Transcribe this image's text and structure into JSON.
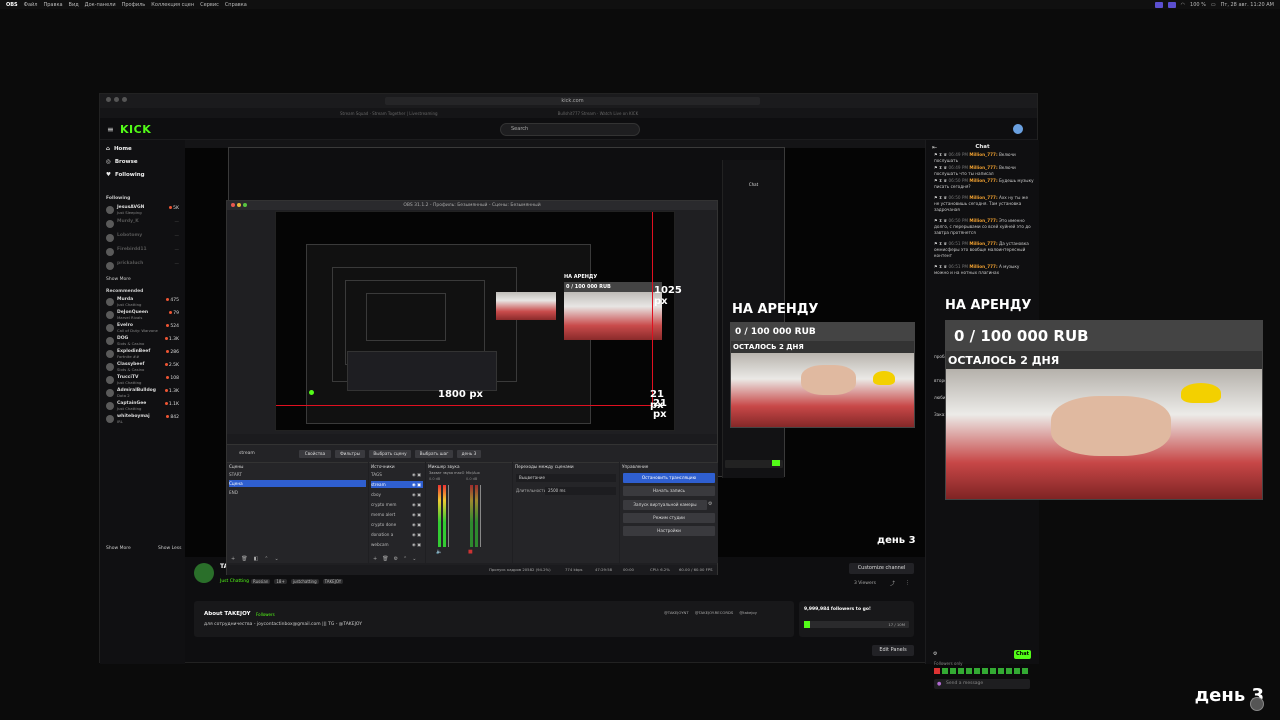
{
  "menubar": {
    "app": "OBS",
    "items": [
      "Файл",
      "Правка",
      "Вид",
      "Док-панели",
      "Профиль",
      "Коллекция сцен",
      "Сервис",
      "Справка"
    ],
    "battery": "100 %",
    "datetime": "Пт, 28 авг. 11:20 AM"
  },
  "browser": {
    "url": "kick.com",
    "tabs": [
      "Stream Squad · Stream Together | Livestreaming",
      "Bullshit777 Stream · Watch Live on KICK"
    ]
  },
  "kick": {
    "logo": "KICK",
    "search_placeholder": "Search",
    "nav": [
      {
        "label": "Home",
        "icon": "home-icon"
      },
      {
        "label": "Browse",
        "icon": "compass-icon"
      },
      {
        "label": "Following",
        "icon": "heart-icon"
      }
    ],
    "following_title": "Following",
    "following": [
      {
        "name": "JesusAVGN",
        "sub": "Just Sleeping",
        "count": "5K",
        "live": true
      },
      {
        "name": "Murdy_K",
        "sub": "",
        "count": "—",
        "live": false
      },
      {
        "name": "Lobotomy",
        "sub": "",
        "count": "—",
        "live": false
      },
      {
        "name": "Firebirdd11",
        "sub": "",
        "count": "—",
        "live": false
      },
      {
        "name": "prickaluch",
        "sub": "",
        "count": "—",
        "live": false
      }
    ],
    "show_more": "Show More",
    "recommended_title": "Recommended",
    "recommended": [
      {
        "name": "Murda",
        "sub": "Just Chatting",
        "count": "475"
      },
      {
        "name": "DeJonQueen",
        "sub": "Marvel Rivals",
        "count": "79"
      },
      {
        "name": "Evelro",
        "sub": "Call of Duty: Warzone",
        "count": "524"
      },
      {
        "name": "DOG",
        "sub": "Slots & Casino",
        "count": "1.3K"
      },
      {
        "name": "ExplodinBeef",
        "sub": "Fortnite ##",
        "count": "286"
      },
      {
        "name": "Classybeef",
        "sub": "Slots & Casino",
        "count": "2.5K"
      },
      {
        "name": "TrucciTV",
        "sub": "Just Chatting",
        "count": "108"
      },
      {
        "name": "AdmiralBulldog",
        "sub": "Dota 2",
        "count": "1.3K"
      },
      {
        "name": "CaptainGee",
        "sub": "Just Chatting",
        "count": "1.1K"
      },
      {
        "name": "whiteboymaj",
        "sub": "IRL",
        "count": "842"
      }
    ],
    "show_more2": "Show More",
    "show_less": "Show Less"
  },
  "chat": {
    "title": "Chat",
    "messages": [
      {
        "time": "06:49 PM",
        "user": "Million_777:",
        "text": "Включи послушать"
      },
      {
        "time": "06:49 PM",
        "user": "Million_777:",
        "text": "Включи послушать что ты написал"
      },
      {
        "time": "06:50 PM",
        "user": "Million_777:",
        "text": "Будешь музыку писать сегодня?"
      },
      {
        "time": "06:50 PM",
        "user": "Million_777:",
        "text": "Ахх ну ты же не установишь сегодня. Там установка задрочаная"
      },
      {
        "time": "06:50 PM",
        "user": "Million_777:",
        "text": "Это именно долго, с перерывами со всей хуйней это до завтра протянется"
      },
      {
        "time": "06:51 PM",
        "user": "Million_777:",
        "text": "Да установка омнисферы это вообще малоинтересный контент"
      },
      {
        "time": "06:51 PM",
        "user": "Million_777:",
        "text": "А музыку можно и на нотных плагинах"
      }
    ],
    "partial": [
      "проблем",
      "второй",
      "люби",
      "Заказ"
    ],
    "followers_only": "Followers only",
    "input_placeholder": "Send a message",
    "send_label": "Chat"
  },
  "obs": {
    "window_title": "OBS 31.1.2 - Профиль: Безымянный - Сцены: Безымянный",
    "scene_name": "stream",
    "toolbar": [
      "Свойства",
      "Фильтры",
      "Выбрать сцену",
      "Выбрать шаг",
      "день 3"
    ],
    "docks": {
      "scenes_title": "Сцены",
      "scenes": [
        "START",
        "Сцена",
        "END"
      ],
      "sources_title": "Источники",
      "sources": [
        "TAGS",
        "stream",
        "cboy",
        "crypto mem",
        "memo alert",
        "crypto done",
        "donation a",
        "webcam"
      ],
      "mixer_title": "Микшер звука",
      "mixer_labels": [
        "Захват звука macO",
        "Mic/Aux"
      ],
      "mixer_levels": [
        "0.0 dB",
        "0.0 dB"
      ],
      "transitions_title": "Переходы между сценами",
      "transition": "Выцветание",
      "duration_label": "Длительность",
      "duration": "2500 ms",
      "controls_title": "Управление",
      "controls": [
        "Остановить трансляцию",
        "Начать запись",
        "Запуск виртуальной камеры",
        "Режим студии",
        "Настройки"
      ]
    },
    "status": {
      "dropped": "Пропуск кадров 20582 (94.2%)",
      "bitrate": "774 kbps",
      "time": "47:29:58",
      "rec_time": "00:00",
      "cpu": "CPU: 6.2%",
      "fps": "60.00 / 60.00 FPS"
    },
    "measure_w": "1800 px",
    "measure_h": "1025 px",
    "measure_px1": "21 px",
    "measure_px2": "21 px"
  },
  "overlay": {
    "goal_text": "0 / 100 000 RUB",
    "remaining": "ОСТАЛОСЬ 2 ДНЯ",
    "rent": "НА АРЕНДУ",
    "day": "день 3"
  },
  "channel": {
    "name": "TAKEJOY",
    "category": "Just Chatting",
    "tags": [
      "Russian",
      "18+",
      "justchatting",
      "TAKEJOY"
    ],
    "customize": "Customize channel",
    "viewers": "3 Viewers",
    "about_title": "About TAKEJOY",
    "followers_label": "Followers",
    "about_text": "для сотрудничества - joycontactinbox@gmail.com ||| TG - @TAKEJOY",
    "socials": [
      "@TAKEJOYNT",
      "@TAKEJOY.RECORDS",
      "@takejoy"
    ],
    "goal_title": "9,999,984 followers to go!",
    "goal_progress": "17 / 10M",
    "edit_panels": "Edit Panels"
  },
  "accent": "#53fc18"
}
